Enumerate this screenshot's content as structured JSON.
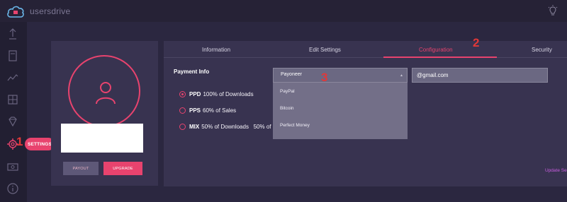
{
  "app": {
    "brand": "usersdrive"
  },
  "sidebar": {
    "icons": [
      "upload-icon",
      "file-icon",
      "chart-icon",
      "folders-icon",
      "diamond-icon",
      "gear-icon",
      "money-icon",
      "info-icon"
    ],
    "settings_label": "SETTINGS"
  },
  "annotations": {
    "one": "1",
    "two": "2",
    "three": "3"
  },
  "profile": {
    "payout_label": "PAYOUT",
    "upgrade_label": "UPGRADE"
  },
  "tabs": [
    "Information",
    "Edit Settings",
    "Configuration",
    "Security"
  ],
  "active_tab": "Configuration",
  "payment": {
    "label": "Payment Info",
    "selected": "Payoneer",
    "options": [
      "PayPal",
      "Bitcoin",
      "Perfect Money"
    ],
    "email_value": "@gmail.com"
  },
  "plans": [
    {
      "code": "PPD",
      "desc": "100% of Downloads",
      "checked": true
    },
    {
      "code": "PPS",
      "desc": "60% of Sales",
      "checked": false
    },
    {
      "code": "MIX",
      "desc": "50% of Downloads   50% of",
      "checked": false
    }
  ],
  "update_label": "Update Se",
  "colors": {
    "accent": "#e8436e",
    "background": "#2b2740",
    "card": "#383350",
    "link": "#c95de0"
  }
}
